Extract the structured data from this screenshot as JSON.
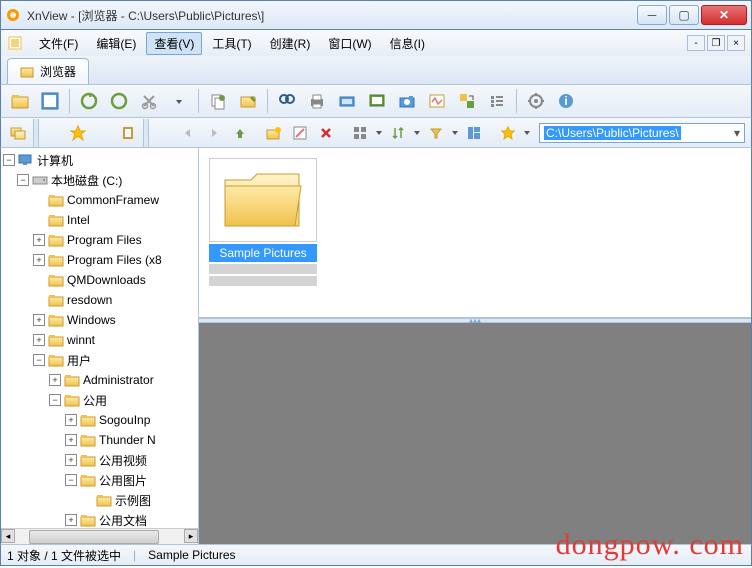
{
  "window": {
    "title": "XnView - [浏览器 - C:\\Users\\Public\\Pictures\\]"
  },
  "menu": {
    "file": "文件(F)",
    "edit": "编辑(E)",
    "view": "查看(V)",
    "tools": "工具(T)",
    "create": "创建(R)",
    "window": "窗口(W)",
    "info": "信息(I)"
  },
  "tab": {
    "label": "浏览器"
  },
  "address": {
    "path": "C:\\Users\\Public\\Pictures\\"
  },
  "tree": {
    "root": "计算机",
    "drive": "本地磁盘 (C:)",
    "items": [
      "CommonFramew",
      "Intel",
      "Program Files",
      "Program Files (x8",
      "QMDownloads",
      "resdown",
      "Windows",
      "winnt",
      "用户"
    ],
    "users_children": [
      "Administrator",
      "公用"
    ],
    "public_children": [
      "SogouInp",
      "Thunder N",
      "公用视频",
      "公用图片",
      "公用文档"
    ],
    "pictures_child": "示例图"
  },
  "thumbs": {
    "item1": {
      "label": "Sample Pictures"
    }
  },
  "status": {
    "left": "1 对象 / 1 文件被选中",
    "right": "Sample Pictures"
  },
  "watermark": "dongpow. com"
}
